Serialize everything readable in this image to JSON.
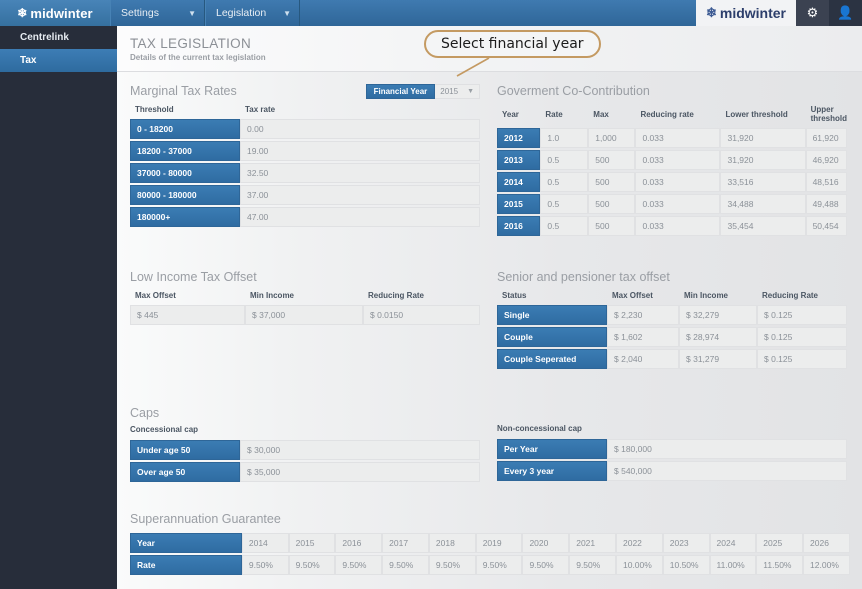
{
  "topbar": {
    "brand": "midwinter",
    "brand_icon": "snowflake-icon",
    "nav": [
      {
        "label": "Settings",
        "caret": "⌄"
      },
      {
        "label": "Legislation",
        "caret": "⌄"
      }
    ],
    "brand_right": "midwinter",
    "settings_icon": "⚙",
    "user_icon": "👤"
  },
  "sidebar": {
    "items": [
      {
        "label": "Centrelink",
        "active": false
      },
      {
        "label": "Tax",
        "active": true
      }
    ]
  },
  "page": {
    "title": "TAX LEGISLATION",
    "subtitle": "Details of the current tax legislation"
  },
  "annotation": {
    "text": "Select financial year",
    "border_color": "#c49a62"
  },
  "financial_year": {
    "label": "Financial Year",
    "value": "2015",
    "caret": "▼"
  },
  "marginal": {
    "title": "Marginal Tax Rates",
    "headers": [
      "Threshold",
      "Tax rate"
    ],
    "rows": [
      [
        "0 - 18200",
        "0.00"
      ],
      [
        "18200 - 37000",
        "19.00"
      ],
      [
        "37000 - 80000",
        "32.50"
      ],
      [
        "80000 - 180000",
        "37.00"
      ],
      [
        "180000+",
        "47.00"
      ]
    ]
  },
  "gov_cocontribution": {
    "title": "Goverment Co-Contribution",
    "headers": [
      "Year",
      "Rate",
      "Max",
      "Reducing rate",
      "Lower threshold",
      "Upper threshold"
    ],
    "rows": [
      [
        "2012",
        "1.0",
        "1,000",
        "0.033",
        "31,920",
        "61,920"
      ],
      [
        "2013",
        "0.5",
        "500",
        "0.033",
        "31,920",
        "46,920"
      ],
      [
        "2014",
        "0.5",
        "500",
        "0.033",
        "33,516",
        "48,516"
      ],
      [
        "2015",
        "0.5",
        "500",
        "0.033",
        "34,488",
        "49,488"
      ],
      [
        "2016",
        "0.5",
        "500",
        "0.033",
        "35,454",
        "50,454"
      ]
    ]
  },
  "low_income_offset": {
    "title": "Low Income Tax Offset",
    "headers": [
      "Max Offset",
      "Min Income",
      "Reducing Rate"
    ],
    "rows": [
      [
        "$ 445",
        "$ 37,000",
        "$ 0.0150"
      ]
    ]
  },
  "senior_offset": {
    "title": "Senior and pensioner tax offset",
    "headers": [
      "Status",
      "Max Offset",
      "Min Income",
      "Reducing Rate"
    ],
    "rows": [
      [
        "Single",
        "$ 2,230",
        "$ 32,279",
        "$ 0.125"
      ],
      [
        "Couple",
        "$ 1,602",
        "$ 28,974",
        "$ 0.125"
      ],
      [
        "Couple Seperated",
        "$ 2,040",
        "$ 31,279",
        "$ 0.125"
      ]
    ]
  },
  "caps": {
    "title": "Caps",
    "concessional": {
      "label": "Concessional cap",
      "rows": [
        [
          "Under age 50",
          "$ 30,000"
        ],
        [
          "Over age 50",
          "$ 35,000"
        ]
      ]
    },
    "non_concessional": {
      "label": "Non-concessional cap",
      "rows": [
        [
          "Per Year",
          "$ 180,000"
        ],
        [
          "Every 3 year",
          "$ 540,000"
        ]
      ]
    }
  },
  "super_guarantee": {
    "title": "Superannuation Guarantee",
    "row_labels": [
      "Year",
      "Rate"
    ],
    "years": [
      "2014",
      "2015",
      "2016",
      "2017",
      "2018",
      "2019",
      "2020",
      "2021",
      "2022",
      "2023",
      "2024",
      "2025",
      "2026"
    ],
    "rates": [
      "9.50%",
      "9.50%",
      "9.50%",
      "9.50%",
      "9.50%",
      "9.50%",
      "9.50%",
      "9.50%",
      "10.00%",
      "10.50%",
      "11.00%",
      "11.50%",
      "12.00%"
    ]
  }
}
